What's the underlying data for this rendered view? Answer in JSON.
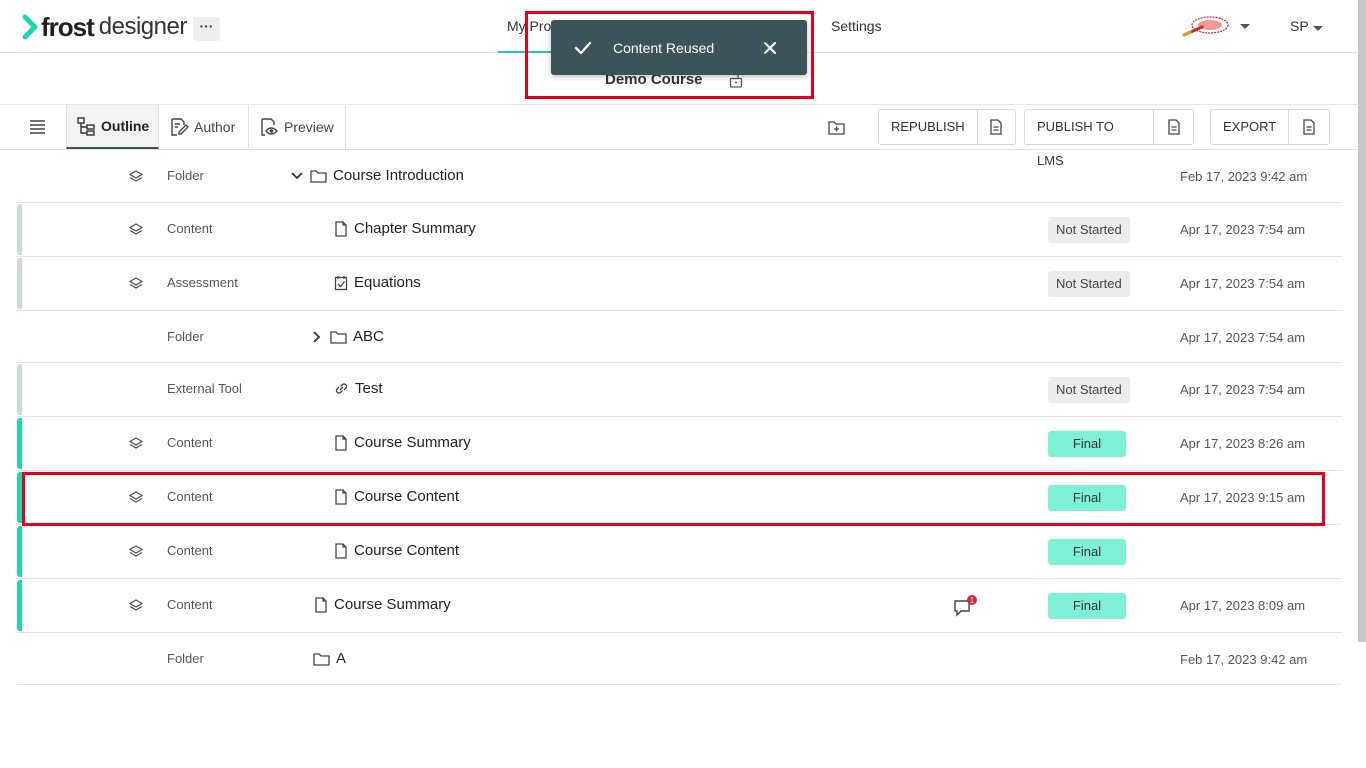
{
  "header": {
    "logo_bold": "frost",
    "logo_text": "designer",
    "more_label": "···",
    "nav_projects": "My Pro",
    "nav_settings": "Settings",
    "user_initials": "SP"
  },
  "toast": {
    "message": "Content Reused"
  },
  "course": {
    "title": "Demo Course"
  },
  "toolbar": {
    "tabs": [
      {
        "label": "Outline",
        "icon": "outline-tree-icon"
      },
      {
        "label": "Author",
        "icon": "author-edit-icon"
      },
      {
        "label": "Preview",
        "icon": "preview-eye-icon"
      }
    ],
    "republish": "REPUBLISH",
    "publish_lms": "PUBLISH TO LMS",
    "export": "EXPORT"
  },
  "rows": [
    {
      "type": "Folder",
      "name": "Course Introduction",
      "icon": "folder-icon",
      "status": "",
      "date": "Feb 17, 2023 9:42 am"
    },
    {
      "type": "Content",
      "name": "Chapter Summary",
      "icon": "document-icon",
      "status": "Not Started",
      "date": "Apr 17, 2023 7:54 am"
    },
    {
      "type": "Assessment",
      "name": "Equations",
      "icon": "checkbox-icon",
      "status": "Not Started",
      "date": "Apr 17, 2023 7:54 am"
    },
    {
      "type": "Folder",
      "name": "ABC",
      "icon": "folder-icon",
      "status": "",
      "date": "Apr 17, 2023 7:54 am"
    },
    {
      "type": "External Tool",
      "name": "Test",
      "icon": "link-icon",
      "status": "Not Started",
      "date": "Apr 17, 2023 7:54 am"
    },
    {
      "type": "Content",
      "name": "Course Summary",
      "icon": "document-icon",
      "status": "Final",
      "date": "Apr 17, 2023 8:26 am"
    },
    {
      "type": "Content",
      "name": "Course Content",
      "icon": "document-icon",
      "status": "Final",
      "date": "Apr 17, 2023 9:15 am"
    },
    {
      "type": "Content",
      "name": "Course Content",
      "icon": "document-icon",
      "status": "Final",
      "date": ""
    },
    {
      "type": "Content",
      "name": "Course Summary",
      "icon": "document-icon",
      "status": "Final",
      "date": "Apr 17, 2023 8:09 am",
      "comment_count": "1"
    },
    {
      "type": "Folder",
      "name": "A",
      "icon": "folder-icon",
      "status": "",
      "date": "Feb 17, 2023 9:42 am"
    }
  ],
  "colors": {
    "accent": "#1fc4bf",
    "toast_bg": "#3c5359",
    "final_badge": "#7ef0d6",
    "highlight": "#e8001a"
  }
}
